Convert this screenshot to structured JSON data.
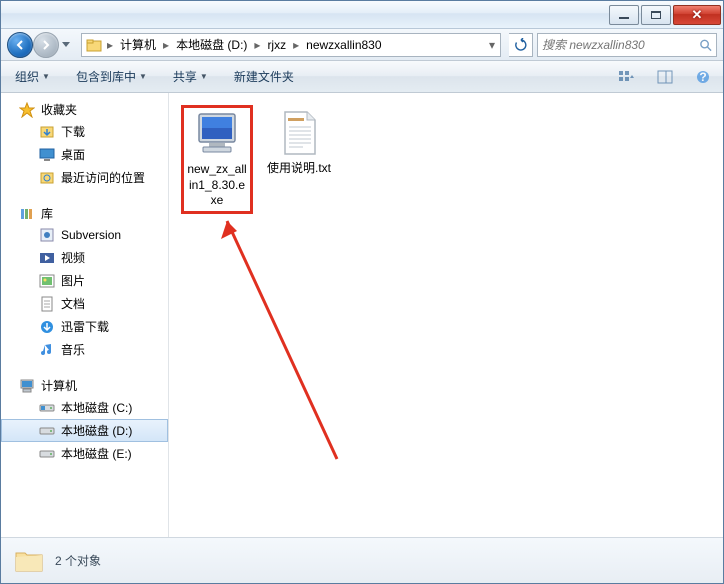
{
  "breadcrumb": {
    "segments": [
      "计算机",
      "本地磁盘 (D:)",
      "rjxz",
      "newzxallin830"
    ]
  },
  "search": {
    "placeholder": "搜索 newzxallin830"
  },
  "toolbar": {
    "organize": "组织",
    "include": "包含到库中",
    "share": "共享",
    "newfolder": "新建文件夹"
  },
  "sidebar": {
    "favorites": {
      "label": "收藏夹",
      "items": [
        "下载",
        "桌面",
        "最近访问的位置"
      ]
    },
    "libraries": {
      "label": "库",
      "items": [
        "Subversion",
        "视频",
        "图片",
        "文档",
        "迅雷下载",
        "音乐"
      ]
    },
    "computer": {
      "label": "计算机",
      "items": [
        "本地磁盘 (C:)",
        "本地磁盘 (D:)",
        "本地磁盘 (E:)"
      ]
    }
  },
  "files": [
    {
      "name": "new_zx_allin1_8.30.exe",
      "type": "exe"
    },
    {
      "name": "使用说明.txt",
      "type": "txt"
    }
  ],
  "status": {
    "text": "2 个对象"
  }
}
